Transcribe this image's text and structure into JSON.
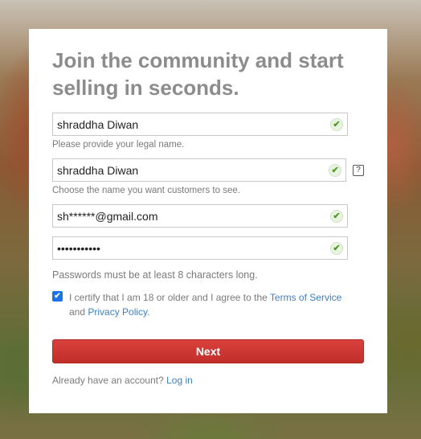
{
  "heading": "Join the community and start selling in seconds.",
  "fields": {
    "legal_name": {
      "value": "shraddha Diwan",
      "hint": "Please provide your legal name."
    },
    "display_name": {
      "value": "shraddha Diwan",
      "hint": "Choose the name you want customers to see.",
      "help_label": "?"
    },
    "email": {
      "value": "sh******@gmail.com"
    },
    "password": {
      "value": "•••••••••••"
    },
    "check_glyph": "✔"
  },
  "password_hint": "Passwords must be at least 8 characters long.",
  "certify": {
    "checked": true,
    "check_glyph": "✔",
    "text_before": "I certify that I am 18 or older and I agree to the ",
    "terms_link": "Terms of Service",
    "text_middle": " and ",
    "privacy_link": "Privacy Policy",
    "text_after": "."
  },
  "next_button": "Next",
  "login": {
    "prompt": "Already have an account?",
    "link": "Log in"
  },
  "colors": {
    "primary_button": "#d9413d",
    "link": "#3b7fc4",
    "check_green": "#4f9a2a",
    "checkbox_blue": "#1a73e8"
  },
  "icons": {
    "field_valid": "check-circle-icon",
    "help": "question-mark-icon",
    "checkbox": "checkmark-icon"
  }
}
